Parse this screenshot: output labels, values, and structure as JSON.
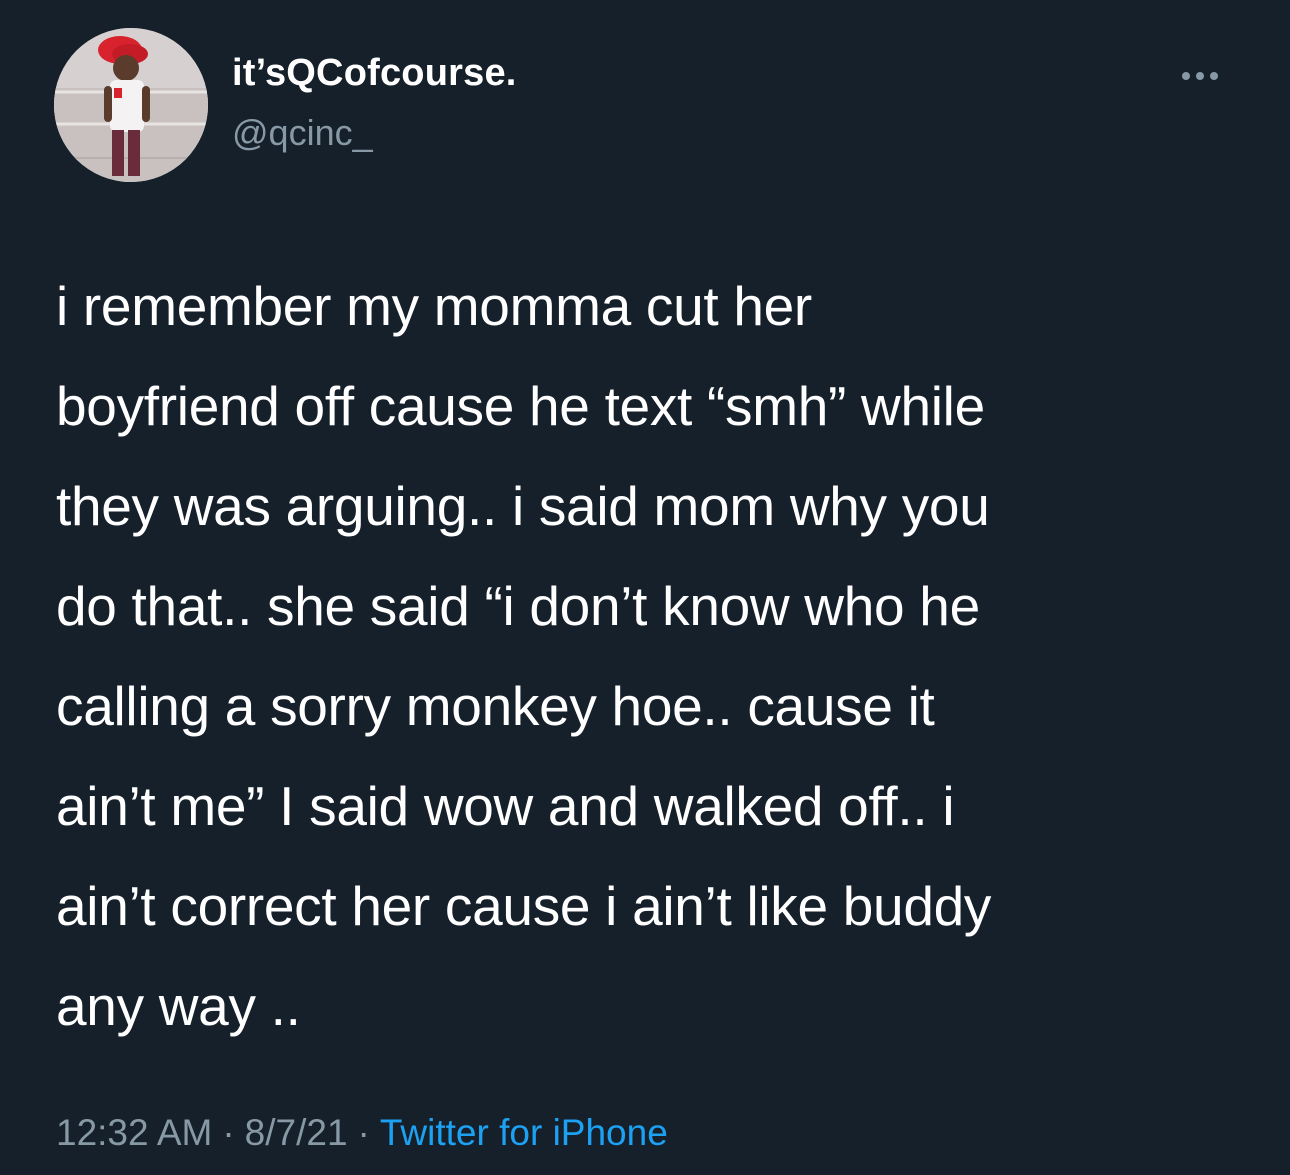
{
  "user": {
    "display_name": "it’sQCofcourse.",
    "handle": "@qcinc_"
  },
  "header": {
    "more_icon": "more-horizontal-icon"
  },
  "tweet": {
    "lines": [
      "i remember my momma cut her",
      "boyfriend off cause he text “smh” while",
      "they was arguing.. i said mom why you",
      "do that.. she said “i don’t know who he",
      "calling a sorry monkey hoe.. cause it",
      "ain’t me” I said wow and walked off.. i",
      "ain’t correct her cause i ain’t like buddy",
      "any way .."
    ]
  },
  "meta": {
    "time": "12:32 AM",
    "separator": "·",
    "date": "8/7/21",
    "source": "Twitter for iPhone"
  },
  "colors": {
    "background": "#15202b",
    "text_primary": "#ffffff",
    "text_secondary": "#8899a6",
    "link": "#1da1f2"
  }
}
